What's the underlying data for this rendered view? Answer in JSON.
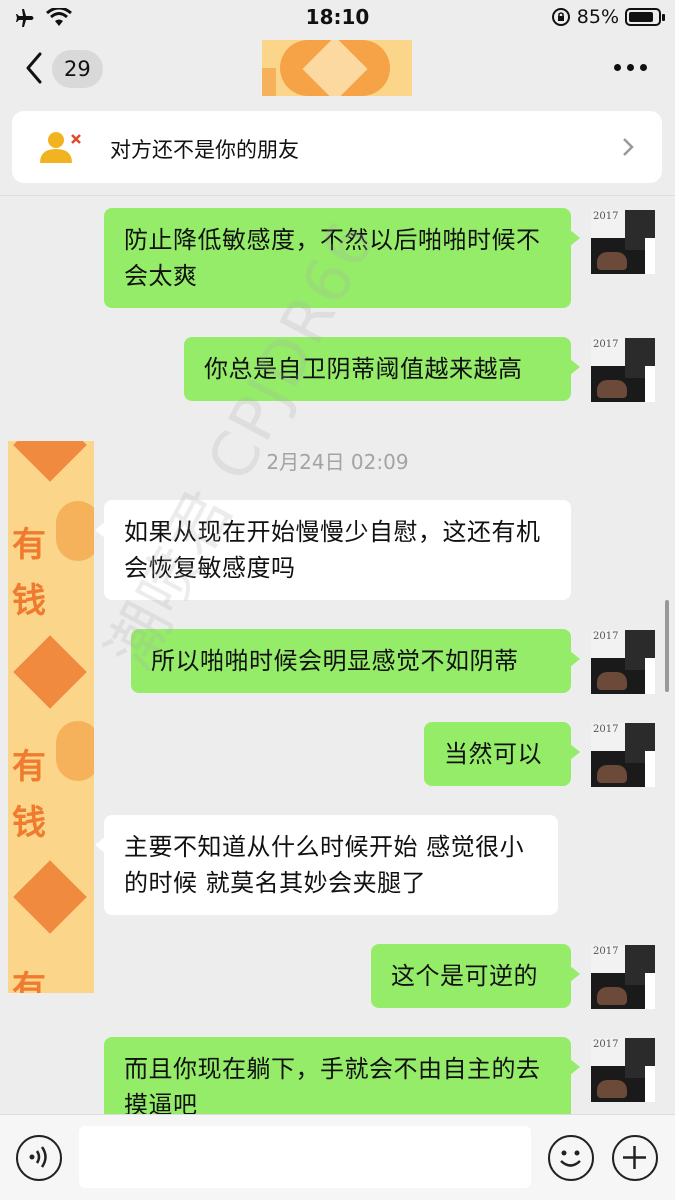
{
  "status_bar": {
    "time": "18:10",
    "battery": "85%",
    "battery_level": 0.85
  },
  "nav": {
    "unread_count": "29"
  },
  "notice": {
    "text": "对方还不是你的朋友"
  },
  "messages": [
    {
      "side": "out",
      "text": "防止降低敏感度，不然以后啪啪时候不会太爽"
    },
    {
      "side": "out",
      "text": "你总是自卫阴蒂阈值越来越高"
    },
    {
      "side": "time",
      "text": "2月24日 02:09"
    },
    {
      "side": "in",
      "text": "如果从现在开始慢慢少自慰，这还有机会恢复敏感度吗"
    },
    {
      "side": "out",
      "text": "所以啪啪时候会明显感觉不如阴蒂"
    },
    {
      "side": "out",
      "text": "当然可以"
    },
    {
      "side": "in",
      "text": "主要不知道从什么时候开始  感觉很小的时候 就莫名其妙会夹腿了"
    },
    {
      "side": "out",
      "text": "这个是可逆的"
    },
    {
      "side": "out",
      "text": "而且你现在躺下，手就会不由自主的去摸逼吧"
    }
  ],
  "avatar_year": "2017",
  "side_strip": {
    "char_1": "有",
    "char_2": "钱"
  },
  "watermark": "潮喷君 CPJDR66",
  "input": {
    "value": ""
  }
}
